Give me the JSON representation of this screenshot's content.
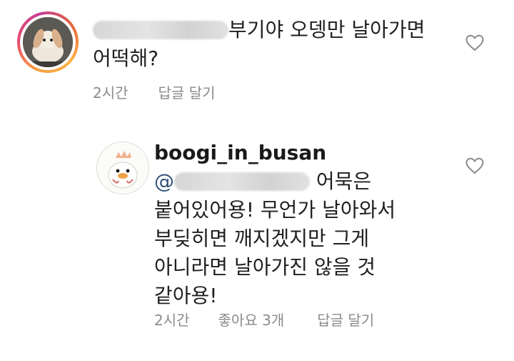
{
  "comments": [
    {
      "username_redacted": true,
      "text_line1": "부기야 오뎅만 날아가면",
      "text_line2": "어떡해?",
      "time": "2시간",
      "reply": "답글 달기"
    },
    {
      "username": "boogi_in_busan",
      "mention_prefix": "@",
      "text_line1": "어묵은",
      "text_line2": "붙어있어용! 무언가 날아와서",
      "text_line3": "부딪히면 깨지겠지만 그게",
      "text_line4": "아니라면 날아가진 않을 것",
      "text_line5": "같아용!",
      "time": "2시간",
      "likes": "좋아요 3개",
      "reply": "답글 달기"
    }
  ],
  "icons": {
    "like": "heart-outline-icon"
  },
  "colors": {
    "meta_text": "#8a8a8a",
    "story_ring": "#e94b6b"
  }
}
